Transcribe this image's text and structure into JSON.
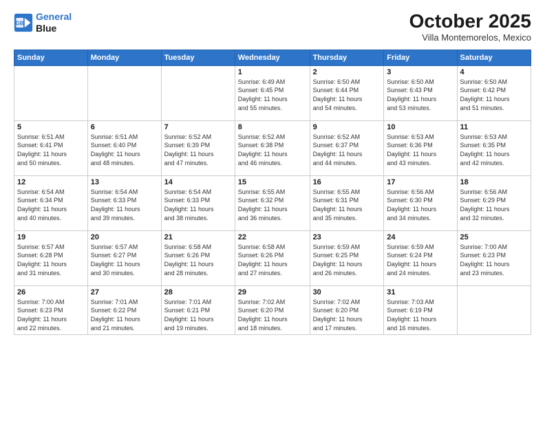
{
  "logo": {
    "line1": "General",
    "line2": "Blue"
  },
  "title": "October 2025",
  "subtitle": "Villa Montemorelos, Mexico",
  "days_header": [
    "Sunday",
    "Monday",
    "Tuesday",
    "Wednesday",
    "Thursday",
    "Friday",
    "Saturday"
  ],
  "weeks": [
    [
      {
        "num": "",
        "info": ""
      },
      {
        "num": "",
        "info": ""
      },
      {
        "num": "",
        "info": ""
      },
      {
        "num": "1",
        "info": "Sunrise: 6:49 AM\nSunset: 6:45 PM\nDaylight: 11 hours\nand 55 minutes."
      },
      {
        "num": "2",
        "info": "Sunrise: 6:50 AM\nSunset: 6:44 PM\nDaylight: 11 hours\nand 54 minutes."
      },
      {
        "num": "3",
        "info": "Sunrise: 6:50 AM\nSunset: 6:43 PM\nDaylight: 11 hours\nand 53 minutes."
      },
      {
        "num": "4",
        "info": "Sunrise: 6:50 AM\nSunset: 6:42 PM\nDaylight: 11 hours\nand 51 minutes."
      }
    ],
    [
      {
        "num": "5",
        "info": "Sunrise: 6:51 AM\nSunset: 6:41 PM\nDaylight: 11 hours\nand 50 minutes."
      },
      {
        "num": "6",
        "info": "Sunrise: 6:51 AM\nSunset: 6:40 PM\nDaylight: 11 hours\nand 48 minutes."
      },
      {
        "num": "7",
        "info": "Sunrise: 6:52 AM\nSunset: 6:39 PM\nDaylight: 11 hours\nand 47 minutes."
      },
      {
        "num": "8",
        "info": "Sunrise: 6:52 AM\nSunset: 6:38 PM\nDaylight: 11 hours\nand 46 minutes."
      },
      {
        "num": "9",
        "info": "Sunrise: 6:52 AM\nSunset: 6:37 PM\nDaylight: 11 hours\nand 44 minutes."
      },
      {
        "num": "10",
        "info": "Sunrise: 6:53 AM\nSunset: 6:36 PM\nDaylight: 11 hours\nand 43 minutes."
      },
      {
        "num": "11",
        "info": "Sunrise: 6:53 AM\nSunset: 6:35 PM\nDaylight: 11 hours\nand 42 minutes."
      }
    ],
    [
      {
        "num": "12",
        "info": "Sunrise: 6:54 AM\nSunset: 6:34 PM\nDaylight: 11 hours\nand 40 minutes."
      },
      {
        "num": "13",
        "info": "Sunrise: 6:54 AM\nSunset: 6:33 PM\nDaylight: 11 hours\nand 39 minutes."
      },
      {
        "num": "14",
        "info": "Sunrise: 6:54 AM\nSunset: 6:33 PM\nDaylight: 11 hours\nand 38 minutes."
      },
      {
        "num": "15",
        "info": "Sunrise: 6:55 AM\nSunset: 6:32 PM\nDaylight: 11 hours\nand 36 minutes."
      },
      {
        "num": "16",
        "info": "Sunrise: 6:55 AM\nSunset: 6:31 PM\nDaylight: 11 hours\nand 35 minutes."
      },
      {
        "num": "17",
        "info": "Sunrise: 6:56 AM\nSunset: 6:30 PM\nDaylight: 11 hours\nand 34 minutes."
      },
      {
        "num": "18",
        "info": "Sunrise: 6:56 AM\nSunset: 6:29 PM\nDaylight: 11 hours\nand 32 minutes."
      }
    ],
    [
      {
        "num": "19",
        "info": "Sunrise: 6:57 AM\nSunset: 6:28 PM\nDaylight: 11 hours\nand 31 minutes."
      },
      {
        "num": "20",
        "info": "Sunrise: 6:57 AM\nSunset: 6:27 PM\nDaylight: 11 hours\nand 30 minutes."
      },
      {
        "num": "21",
        "info": "Sunrise: 6:58 AM\nSunset: 6:26 PM\nDaylight: 11 hours\nand 28 minutes."
      },
      {
        "num": "22",
        "info": "Sunrise: 6:58 AM\nSunset: 6:26 PM\nDaylight: 11 hours\nand 27 minutes."
      },
      {
        "num": "23",
        "info": "Sunrise: 6:59 AM\nSunset: 6:25 PM\nDaylight: 11 hours\nand 26 minutes."
      },
      {
        "num": "24",
        "info": "Sunrise: 6:59 AM\nSunset: 6:24 PM\nDaylight: 11 hours\nand 24 minutes."
      },
      {
        "num": "25",
        "info": "Sunrise: 7:00 AM\nSunset: 6:23 PM\nDaylight: 11 hours\nand 23 minutes."
      }
    ],
    [
      {
        "num": "26",
        "info": "Sunrise: 7:00 AM\nSunset: 6:23 PM\nDaylight: 11 hours\nand 22 minutes."
      },
      {
        "num": "27",
        "info": "Sunrise: 7:01 AM\nSunset: 6:22 PM\nDaylight: 11 hours\nand 21 minutes."
      },
      {
        "num": "28",
        "info": "Sunrise: 7:01 AM\nSunset: 6:21 PM\nDaylight: 11 hours\nand 19 minutes."
      },
      {
        "num": "29",
        "info": "Sunrise: 7:02 AM\nSunset: 6:20 PM\nDaylight: 11 hours\nand 18 minutes."
      },
      {
        "num": "30",
        "info": "Sunrise: 7:02 AM\nSunset: 6:20 PM\nDaylight: 11 hours\nand 17 minutes."
      },
      {
        "num": "31",
        "info": "Sunrise: 7:03 AM\nSunset: 6:19 PM\nDaylight: 11 hours\nand 16 minutes."
      },
      {
        "num": "",
        "info": ""
      }
    ]
  ]
}
